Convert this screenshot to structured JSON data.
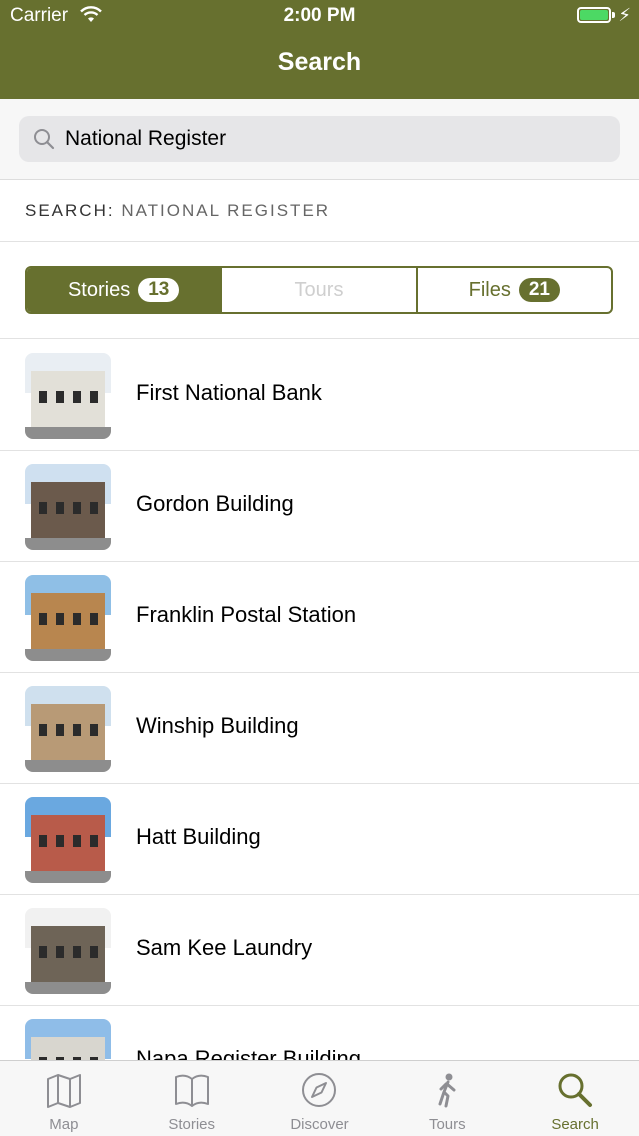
{
  "status_bar": {
    "carrier": "Carrier",
    "time": "2:00 PM"
  },
  "nav": {
    "title": "Search"
  },
  "search": {
    "value": "National Register"
  },
  "query_label": {
    "prefix": "SEARCH:",
    "term": "NATIONAL REGISTER"
  },
  "segments": [
    {
      "label": "Stories",
      "count": "13",
      "state": "active"
    },
    {
      "label": "Tours",
      "count": "",
      "state": "disabled"
    },
    {
      "label": "Files",
      "count": "21",
      "state": "normal"
    }
  ],
  "results": [
    {
      "title": "First National Bank",
      "sky": "#e9eef3",
      "building": "#e2e0d8"
    },
    {
      "title": "Gordon Building",
      "sky": "#cfe0f0",
      "building": "#6b5a4c"
    },
    {
      "title": "Franklin Postal Station",
      "sky": "#8fbfe6",
      "building": "#b8864f"
    },
    {
      "title": "Winship Building",
      "sky": "#cfe0ee",
      "building": "#b89a76"
    },
    {
      "title": "Hatt Building",
      "sky": "#6aa8e0",
      "building": "#b85b4a"
    },
    {
      "title": "Sam Kee Laundry",
      "sky": "#f1f1f1",
      "building": "#6e6457"
    },
    {
      "title": "Napa Register Building",
      "sky": "#8fbde8",
      "building": "#d8d6cf"
    }
  ],
  "tabbar": [
    {
      "label": "Map",
      "icon": "map-icon",
      "active": false
    },
    {
      "label": "Stories",
      "icon": "book-icon",
      "active": false
    },
    {
      "label": "Discover",
      "icon": "compass-icon",
      "active": false
    },
    {
      "label": "Tours",
      "icon": "walking-icon",
      "active": false
    },
    {
      "label": "Search",
      "icon": "search-icon",
      "active": true
    }
  ],
  "colors": {
    "accent": "#67702f",
    "inactive": "#8e8e93"
  }
}
